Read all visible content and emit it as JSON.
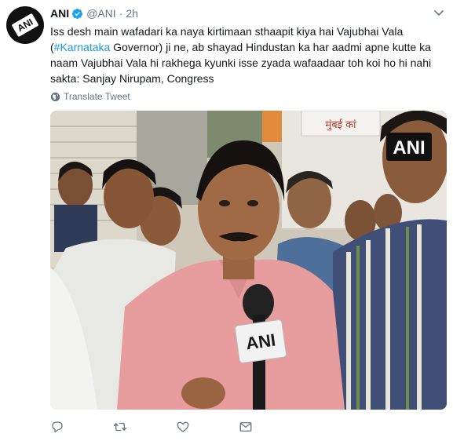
{
  "tweet": {
    "author_name": "ANI",
    "handle": "@ANI",
    "separator": "·",
    "time": "2h",
    "text_part1": "Iss desh main wafadari ka naya kirtimaan sthaapit kiya hai Vajubhai Vala (",
    "hashtag": "#Karnataka",
    "text_part2": " Governor) ji ne, ab shayad Hindustan ka har aadmi apne kutte ka naam Vajubhai Vala hi rakhega kyunki isse zyada wafaadaar toh koi ho hi nahi sakta: Sanjay Nirupam, Congress",
    "translate_label": "Translate Tweet",
    "avatar_text": "ANI",
    "watermark": "ANI",
    "mic_logo": "ANI",
    "sign_text": "मुंबई कां"
  },
  "colors": {
    "link": "#1b95e0",
    "verified": "#1da1f2",
    "muted": "#657786"
  },
  "icons": {
    "verified": "verified-badge-icon",
    "more": "chevron-down-icon",
    "globe": "globe-icon",
    "reply": "reply-icon",
    "retweet": "retweet-icon",
    "like": "heart-icon",
    "dm": "envelope-icon"
  }
}
